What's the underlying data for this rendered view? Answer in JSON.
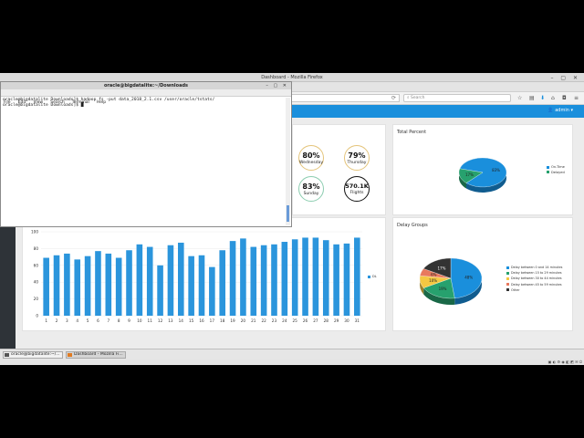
{
  "browser": {
    "window_title": "Dashboard - Mozilla Firefox",
    "search_placeholder": "Search",
    "user": "admin"
  },
  "dashboard": {
    "total_percent_title": "Total Percent",
    "delay_groups_title": "Delay Groups",
    "stats": [
      {
        "value": "80%",
        "label": "Wednesday"
      },
      {
        "value": "79%",
        "label": "Thursday"
      },
      {
        "value": "83%",
        "label": "Sunday"
      },
      {
        "value": "570.1K",
        "label": "Flights"
      }
    ],
    "total_percent_legend": [
      "On-Time",
      "Delayed"
    ],
    "delay_groups_legend": [
      "Delay between 0 and 14 minutes",
      "Delay between 15 to 29 minutes",
      "Delay between 30 to 44 minutes",
      "Delay between 45 to 59 minutes",
      "Other"
    ]
  },
  "chart_data": [
    {
      "type": "bar",
      "title": "",
      "categories": [
        "1",
        "2",
        "3",
        "4",
        "5",
        "6",
        "7",
        "8",
        "9",
        "10",
        "11",
        "12",
        "13",
        "14",
        "15",
        "16",
        "17",
        "18",
        "19",
        "20",
        "21",
        "22",
        "23",
        "24",
        "25",
        "26",
        "27",
        "28",
        "29",
        "30",
        "31"
      ],
      "series": [
        {
          "name": "DL",
          "values": [
            69,
            72,
            74,
            67,
            71,
            77,
            74,
            69,
            78,
            85,
            82,
            60,
            84,
            87,
            71,
            72,
            58,
            78,
            89,
            92,
            82,
            84,
            85,
            88,
            91,
            93,
            93,
            90,
            85,
            86,
            93
          ]
        }
      ],
      "ylim": [
        0,
        100
      ],
      "yticks": [
        "0",
        "20",
        "40",
        "60",
        "80",
        "100"
      ],
      "color": "#2b95dc"
    },
    {
      "type": "pie",
      "labels": [
        "On-Time",
        "Delayed"
      ],
      "values": [
        83,
        17
      ],
      "display_labels": [
        "83%",
        "17%"
      ],
      "colors": [
        "#1a8fdc",
        "#27a16e"
      ]
    },
    {
      "type": "pie",
      "labels": [
        "Delay between 0 and 14 minutes",
        "Delay between 15 to 29 minutes",
        "Delay between 30 to 44 minutes",
        "Delay between 45 to 59 minutes",
        "Other"
      ],
      "values": [
        48,
        19,
        10,
        6,
        17
      ],
      "display_labels": [
        "48%",
        "19%",
        "10%",
        "6%",
        "17%"
      ],
      "colors": [
        "#1a8fdc",
        "#27a16e",
        "#f4c842",
        "#e8795e",
        "#333333"
      ]
    }
  ],
  "terminal": {
    "title": "oracle@bigdatalite:~/Downloads",
    "menu": [
      "File",
      "Edit",
      "View",
      "Search",
      "Terminal",
      "Help"
    ],
    "lines": [
      "oracle@bigdatalite Downloads]$ hadoop fs -put data_2018_2.1.csv /user/oracle/tstats/",
      "oracle@bigdatalite Downloads]$ █"
    ]
  },
  "taskbar": {
    "items": [
      "oracle@bigdatalite:~/...",
      "Dashboard - Mozilla Fi..."
    ]
  }
}
